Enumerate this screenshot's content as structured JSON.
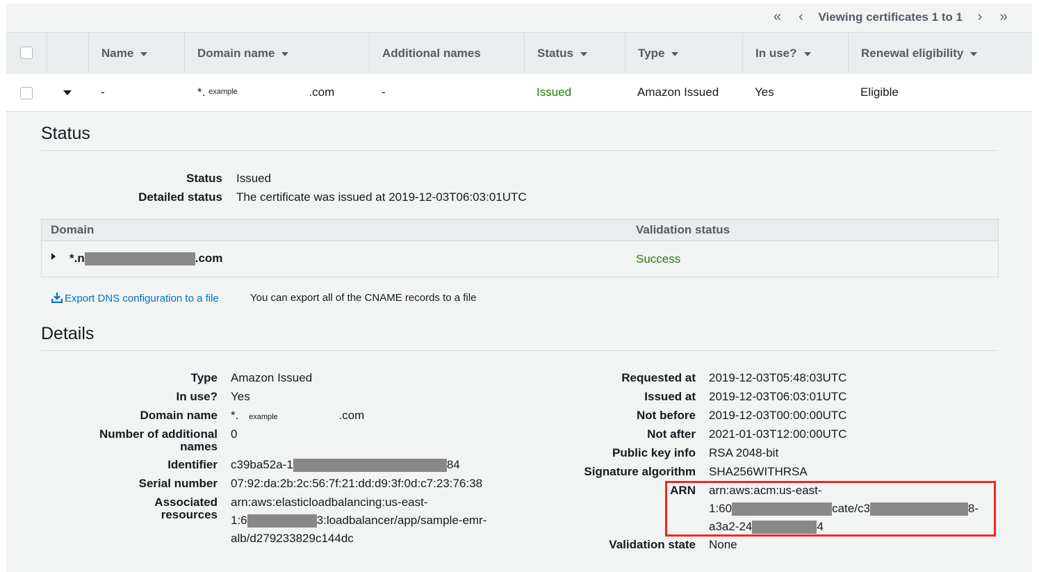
{
  "pager": {
    "first": "«",
    "prev": "‹",
    "text": "Viewing certificates 1 to 1",
    "next": "›",
    "last": "»"
  },
  "table": {
    "headers": [
      "Name",
      "Domain name",
      "Additional names",
      "Status",
      "Type",
      "In use?",
      "Renewal eligibility"
    ],
    "row": {
      "name": "-",
      "domain_prefix": "*.",
      "domain_example": "example",
      "domain_suffix": ".com",
      "additional_names": "-",
      "status": "Issued",
      "type": "Amazon Issued",
      "in_use": "Yes",
      "renewal": "Eligible"
    }
  },
  "status_section": {
    "title": "Status",
    "status_label": "Status",
    "status_value": "Issued",
    "detailed_label": "Detailed status",
    "detailed_value": "The certificate was issued at 2019-12-03T06:03:01UTC"
  },
  "validation": {
    "col_domain": "Domain",
    "col_status": "Validation status",
    "domain_prefix": "*.n",
    "domain_suffix": ".com",
    "status": "Success"
  },
  "export": {
    "link": "Export DNS configuration to a file",
    "note": "You can export all of the CNAME records to a file"
  },
  "details": {
    "title": "Details",
    "left": {
      "type_label": "Type",
      "type_value": "Amazon Issued",
      "inuse_label": "In use?",
      "inuse_value": "Yes",
      "domain_label": "Domain name",
      "domain_prefix": "*.",
      "domain_example": "example",
      "domain_suffix": ".com",
      "addl_label_1": "Number of additional",
      "addl_label_2": "names",
      "addl_value": "0",
      "identifier_label": "Identifier",
      "identifier_start": "c39ba52a-1",
      "identifier_end": "84",
      "serial_label": "Serial number",
      "serial_value": "07:92:da:2b:2c:56:7f:21:dd:d9:3f:0d:c7:23:76:38",
      "assoc_label_1": "Associated",
      "assoc_label_2": "resources",
      "assoc_line1": "arn:aws:elasticloadbalancing:us-east-",
      "assoc_line2_start": "1:6",
      "assoc_line2_end": "3:loadbalancer/app/sample-emr-",
      "assoc_line3": "alb/d279233829c144dc"
    },
    "right": {
      "requested_label": "Requested at",
      "requested_value": "2019-12-03T05:48:03UTC",
      "issued_label": "Issued at",
      "issued_value": "2019-12-03T06:03:01UTC",
      "notbefore_label": "Not before",
      "notbefore_value": "2019-12-03T00:00:00UTC",
      "notafter_label": "Not after",
      "notafter_value": "2021-01-03T12:00:00UTC",
      "pubkey_label": "Public key info",
      "pubkey_value": "RSA 2048-bit",
      "sigalg_label": "Signature algorithm",
      "sigalg_value": "SHA256WITHRSA",
      "arn_label": "ARN",
      "arn_line1": "arn:aws:acm:us-east-",
      "arn_line2_a": "1:60",
      "arn_line2_b": "cate/c3",
      "arn_line2_c": "8-",
      "arn_line3_a": "a3a2-24",
      "arn_line3_b": "4",
      "validation_label": "Validation state",
      "validation_value": "None"
    }
  },
  "colors": {
    "success": "#1d8102",
    "link": "#0073bb",
    "highlight": "#f0281e"
  }
}
